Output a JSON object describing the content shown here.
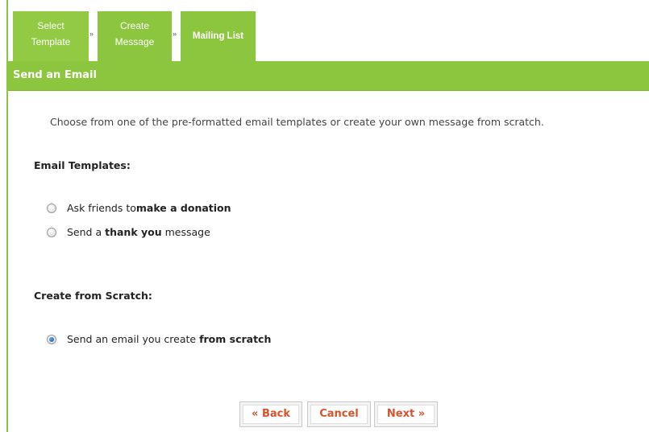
{
  "steps": [
    {
      "line1": "Select",
      "line2": "Template"
    },
    {
      "line1": "Create",
      "line2": "Message"
    },
    {
      "label": "Mailing List"
    }
  ],
  "step_separator": "»",
  "header": {
    "title": "Send an Email"
  },
  "intro_text": "Choose from one of the pre-formatted email templates or create your own message from scratch.",
  "templates_section": {
    "title": "Email Templates:",
    "options": [
      {
        "prefix": "Ask friends to ",
        "bold": "make a donation",
        "suffix": "",
        "checked": false
      },
      {
        "prefix": "Send a ",
        "bold": "thank you",
        "suffix": " message",
        "checked": false
      }
    ]
  },
  "scratch_section": {
    "title": "Create from Scratch:",
    "options": [
      {
        "prefix": "Send an email you create ",
        "bold": "from scratch",
        "suffix": "",
        "checked": true
      }
    ]
  },
  "buttons": {
    "back": "« Back",
    "cancel": "Cancel",
    "next": "Next »"
  },
  "colors": {
    "accent_green": "#8cc63f",
    "button_text": "#d9532a"
  }
}
